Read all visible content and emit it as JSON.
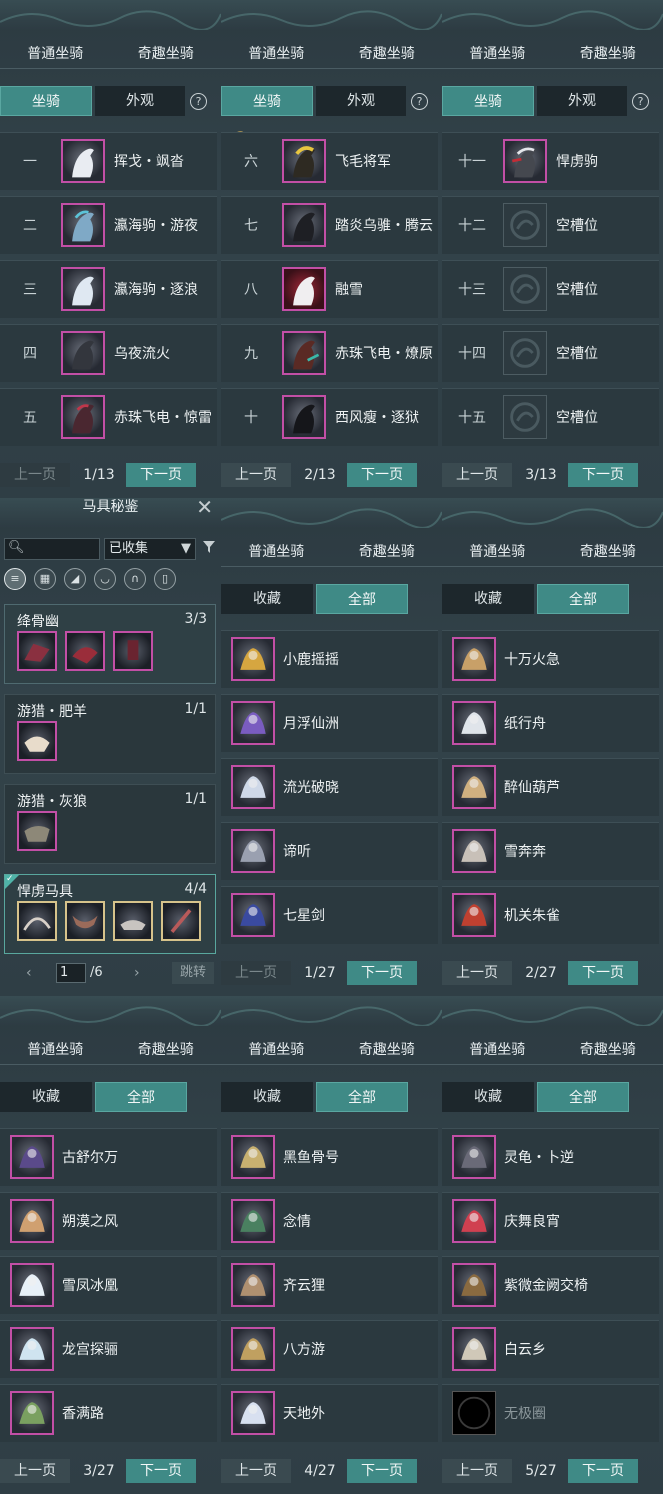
{
  "category_tabs": [
    "普通坐骑",
    "奇趣坐骑"
  ],
  "mount_subtabs": {
    "mount": "坐骑",
    "appearance": "外观"
  },
  "collection_subtabs": {
    "favorites": "收藏",
    "all": "全部"
  },
  "help_label": "?",
  "pager_labels": {
    "prev": "上一页",
    "next": "下一页"
  },
  "mount_pages": [
    {
      "page": "1/13",
      "rows": [
        {
          "num": "一",
          "name": "挥戈・飒沓"
        },
        {
          "num": "二",
          "name": "瀛海驹・游夜"
        },
        {
          "num": "三",
          "name": "瀛海驹・逐浪"
        },
        {
          "num": "四",
          "name": "乌夜流火"
        },
        {
          "num": "五",
          "name": "赤珠飞电・惊雷"
        }
      ]
    },
    {
      "page": "2/13",
      "rows": [
        {
          "num": "六",
          "name": "飞毛将军"
        },
        {
          "num": "七",
          "name": "踏炎乌骓・腾云"
        },
        {
          "num": "八",
          "name": "融雪"
        },
        {
          "num": "九",
          "name": "赤珠飞电・燎原"
        },
        {
          "num": "十",
          "name": "西风瘦・逐狱"
        }
      ]
    },
    {
      "page": "3/13",
      "rows": [
        {
          "num": "十一",
          "name": "悍虏驹"
        },
        {
          "num": "十二",
          "name": "空槽位"
        },
        {
          "num": "十三",
          "name": "空槽位"
        },
        {
          "num": "十四",
          "name": "空槽位"
        },
        {
          "num": "十五",
          "name": "空槽位"
        }
      ]
    }
  ],
  "codex": {
    "title": "马具秘鉴",
    "close": "✕",
    "search_icon": "search-icon",
    "filter_value": "已收集",
    "filter_arrow": "▼",
    "funnel": "▼",
    "sets": [
      {
        "name": "绛骨幽",
        "count": "3/3",
        "items": 3
      },
      {
        "name": "游猎・肥羊",
        "count": "1/1",
        "items": 1
      },
      {
        "name": "游猎・灰狼",
        "count": "1/1",
        "items": 1
      },
      {
        "name": "悍虏马具",
        "count": "4/4",
        "items": 4
      }
    ],
    "check": "✓",
    "page_input": "1",
    "page_total": "/6",
    "prev_arrow": "‹",
    "next_arrow": "›",
    "jump": "跳转"
  },
  "fun_pages": [
    {
      "page": "1/27",
      "prev_disabled": true,
      "items": [
        "小鹿摇摇",
        "月浮仙洲",
        "流光破晓",
        "谛听",
        "七星剑"
      ]
    },
    {
      "page": "2/27",
      "prev_disabled": false,
      "items": [
        "十万火急",
        "纸行舟",
        "醉仙葫芦",
        "雪奔奔",
        "机关朱雀"
      ]
    },
    {
      "page": "3/27",
      "prev_disabled": false,
      "items": [
        "古舒尔万",
        "朔漠之风",
        "雪凤冰凰",
        "龙宫探骊",
        "香满路"
      ]
    },
    {
      "page": "4/27",
      "prev_disabled": false,
      "items": [
        "黑鱼骨号",
        "念情",
        "齐云狸",
        "八方游",
        "天地外"
      ]
    },
    {
      "page": "5/27",
      "prev_disabled": false,
      "items": [
        "灵龟・卜逆",
        "庆舞良宵",
        "紫微金阙交椅",
        "白云乡",
        "无极圈"
      ]
    }
  ]
}
